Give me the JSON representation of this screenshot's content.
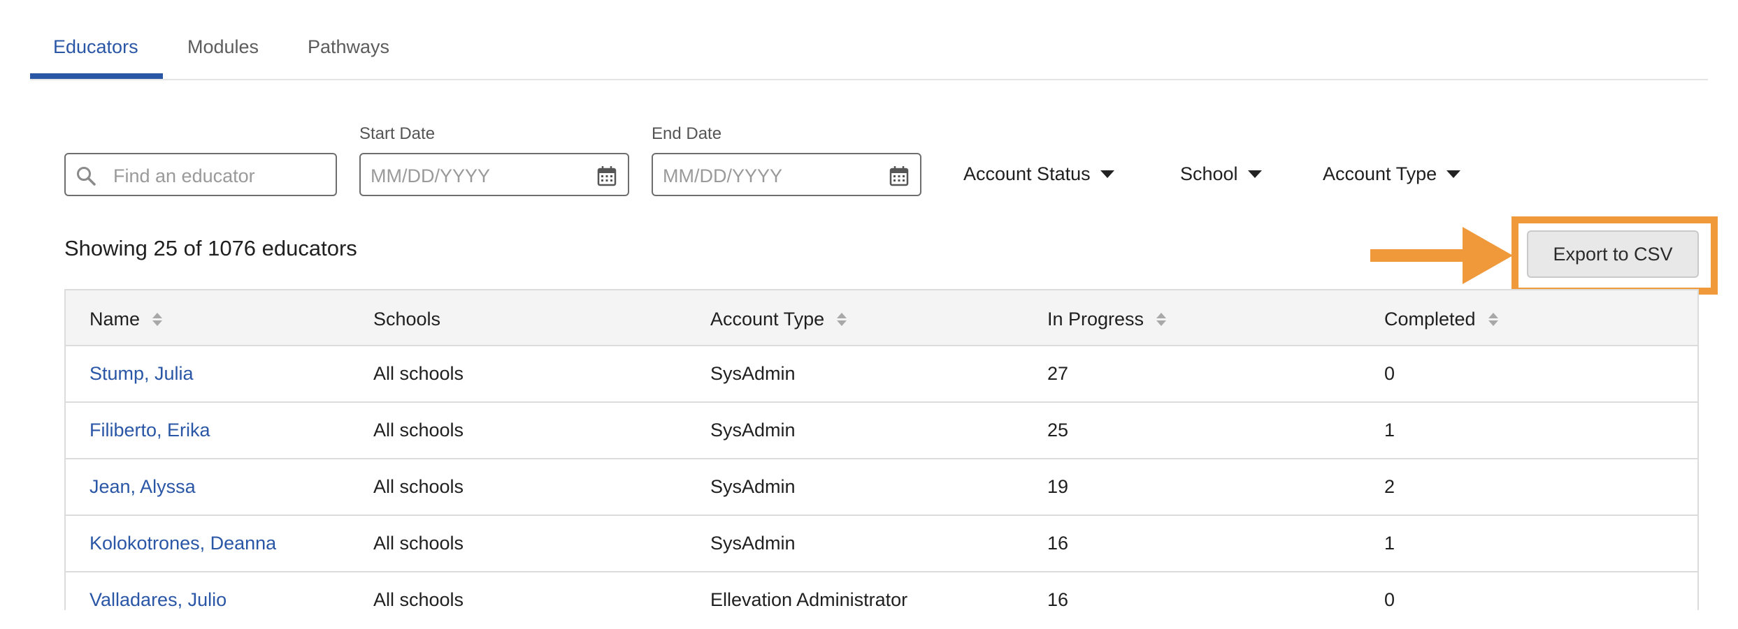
{
  "tabs": [
    {
      "label": "Educators",
      "active": true
    },
    {
      "label": "Modules",
      "active": false
    },
    {
      "label": "Pathways",
      "active": false
    }
  ],
  "filters": {
    "search_placeholder": "Find an educator",
    "start_date_label": "Start Date",
    "start_date_placeholder": "MM/DD/YYYY",
    "end_date_label": "End Date",
    "end_date_placeholder": "MM/DD/YYYY",
    "account_status": "Account Status",
    "school": "School",
    "account_type": "Account Type"
  },
  "summary": "Showing 25 of 1076 educators",
  "export_label": "Export to CSV",
  "colors": {
    "accent": "#2a56a6",
    "highlight": "#f0993a"
  },
  "table": {
    "headers": {
      "name": "Name",
      "schools": "Schools",
      "account_type": "Account Type",
      "in_progress": "In Progress",
      "completed": "Completed"
    },
    "rows": [
      {
        "name": "Stump, Julia",
        "schools": "All schools",
        "account_type": "SysAdmin",
        "in_progress": "27",
        "completed": "0"
      },
      {
        "name": "Filiberto, Erika",
        "schools": "All schools",
        "account_type": "SysAdmin",
        "in_progress": "25",
        "completed": "1"
      },
      {
        "name": "Jean, Alyssa",
        "schools": "All schools",
        "account_type": "SysAdmin",
        "in_progress": "19",
        "completed": "2"
      },
      {
        "name": "Kolokotrones, Deanna",
        "schools": "All schools",
        "account_type": "SysAdmin",
        "in_progress": "16",
        "completed": "1"
      },
      {
        "name": "Valladares, Julio",
        "schools": "All schools",
        "account_type": "Ellevation Administrator",
        "in_progress": "16",
        "completed": "0"
      }
    ]
  }
}
